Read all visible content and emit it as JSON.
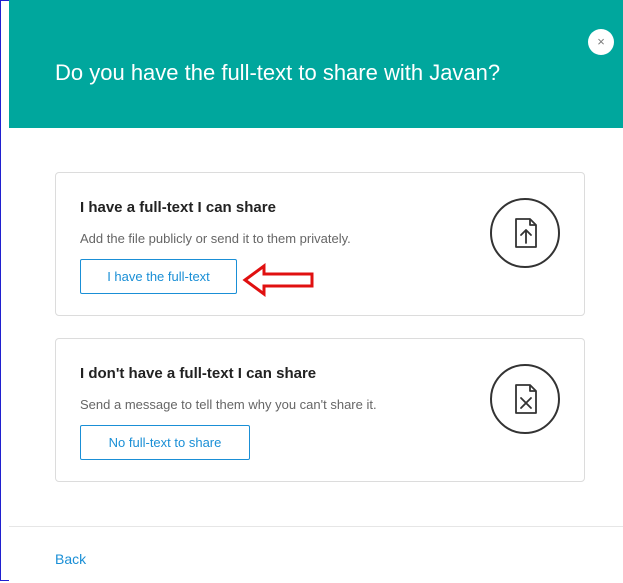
{
  "dialog": {
    "title": "Do you have the full-text to share with Javan?",
    "close_label": "×"
  },
  "options": [
    {
      "title": "I have a full-text I can share",
      "description": "Add the file publicly or send it to them privately.",
      "button_label": "I have the full-text",
      "icon": "file-upload-icon"
    },
    {
      "title": "I don't have a full-text I can share",
      "description": "Send a message to tell them why you can't share it.",
      "button_label": "No full-text to share",
      "icon": "file-cancel-icon"
    }
  ],
  "footer": {
    "back_label": "Back"
  },
  "annotation": {
    "icon": "red-arrow-icon",
    "color": "#e01010"
  },
  "colors": {
    "header": "#00a79d",
    "accent": "#1a8fd6",
    "frame": "#2020d0"
  }
}
